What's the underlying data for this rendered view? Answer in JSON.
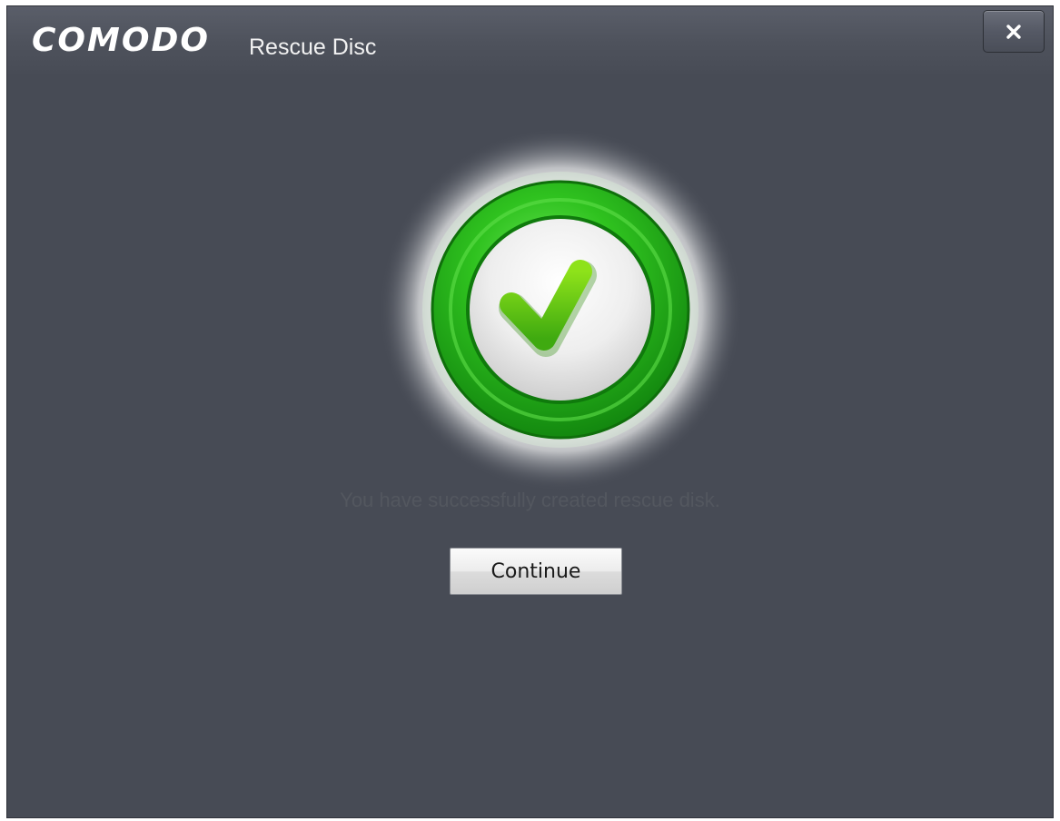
{
  "window": {
    "brand": "COMODO",
    "title": "Rescue Disc",
    "close_icon": "close-icon"
  },
  "main": {
    "status_icon": "success-checkmark-icon",
    "message": "You have successfully created rescue disk.",
    "continue_label": "Continue"
  },
  "colors": {
    "background": "#474b55",
    "accent_green": "#2cb61e",
    "message_text": "#53575f"
  }
}
